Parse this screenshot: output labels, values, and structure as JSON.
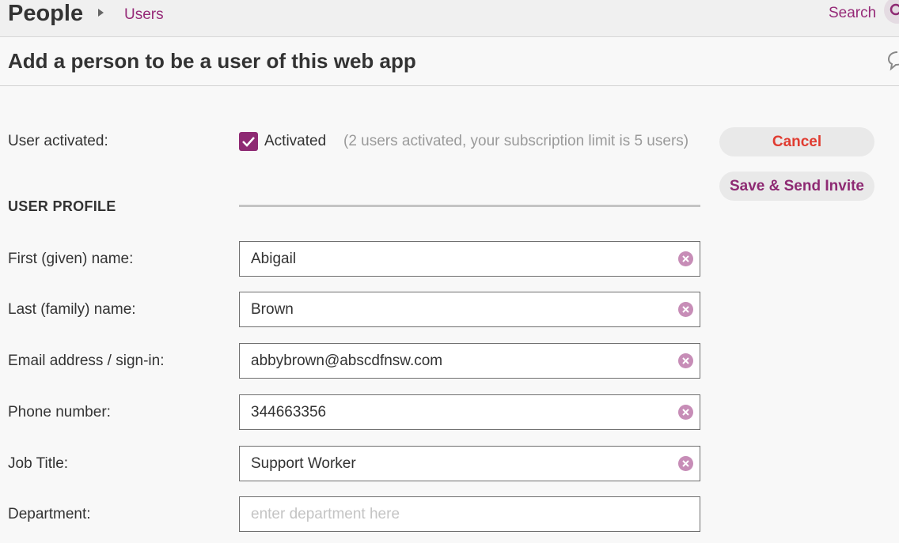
{
  "breadcrumb": {
    "title": "People",
    "link": "Users"
  },
  "header": {
    "search_label": "Search"
  },
  "page_title": "Add a person to be a user of this web app",
  "activation": {
    "label": "User activated:",
    "checkbox_label": "Activated",
    "checked": true,
    "note": "(2 users activated, your subscription limit is 5 users)"
  },
  "section": {
    "heading": "USER PROFILE"
  },
  "fields": {
    "first_name": {
      "label": "First (given) name:",
      "value": "Abigail"
    },
    "last_name": {
      "label": "Last (family) name:",
      "value": "Brown"
    },
    "email": {
      "label": "Email address / sign-in:",
      "value": "abbybrown@abscdfnsw.com"
    },
    "phone": {
      "label": "Phone number:",
      "value": "344663356"
    },
    "job_title": {
      "label": "Job Title:",
      "value": "Support Worker"
    },
    "department": {
      "label": "Department:",
      "value": "",
      "placeholder": "enter department here"
    }
  },
  "buttons": {
    "cancel": "Cancel",
    "save": "Save & Send Invite"
  },
  "colors": {
    "brand": "#8e2a73",
    "cancel": "#e03c31",
    "clear_icon": "#c78db7"
  },
  "icons": {
    "search": "search-icon",
    "help": "chat-bubble-icon",
    "clear": "clear-circle-icon",
    "check": "checkmark-icon"
  }
}
